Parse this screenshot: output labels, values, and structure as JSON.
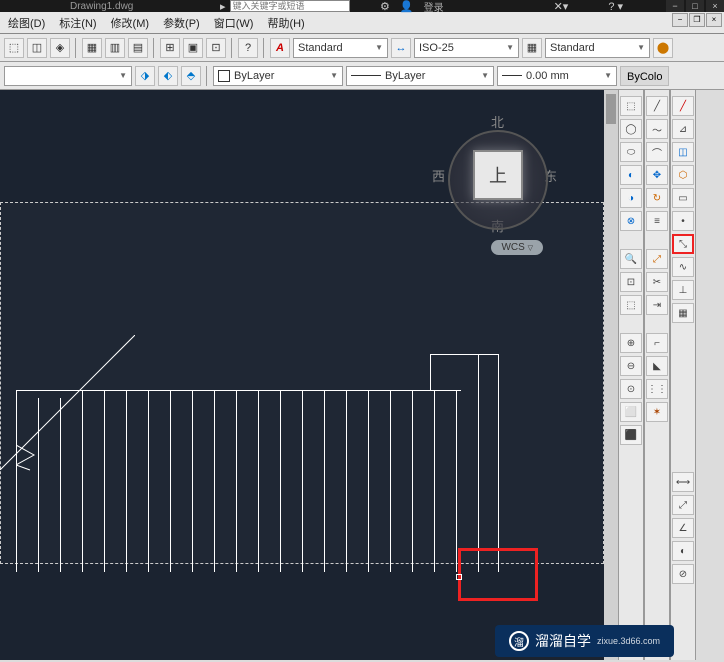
{
  "title": "Drawing1.dwg",
  "search_placeholder": "键入关键字或短语",
  "login_label": "登录",
  "menu": {
    "draw": "绘图(D)",
    "dimension": "标注(N)",
    "modify": "修改(M)",
    "param": "参数(P)",
    "window": "窗口(W)",
    "help": "帮助(H)"
  },
  "style_dropdowns": {
    "text_style": "Standard",
    "dim_style": "ISO-25",
    "table_style": "Standard"
  },
  "layer_dropdowns": {
    "linetype": "ByLayer",
    "linetype2": "ByLayer",
    "lineweight": "0.00 mm",
    "bycolor": "ByColo"
  },
  "viewcube": {
    "top_face": "上",
    "north": "北",
    "south": "南",
    "east": "东",
    "west": "西",
    "wcs": "WCS"
  },
  "watermark": {
    "brand": "溜溜自学",
    "url": "zixue.3d66.com"
  },
  "font_label": "A"
}
